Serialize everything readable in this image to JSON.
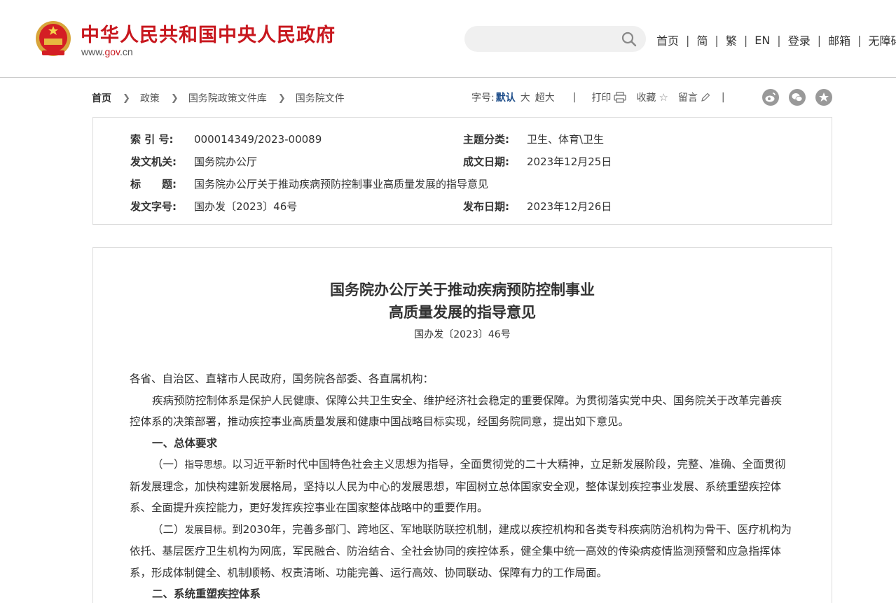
{
  "header": {
    "site_title": "中华人民共和国中央人民政府",
    "site_url_prefix": "www.",
    "site_url_gov": "gov",
    "site_url_suffix": ".cn",
    "search_placeholder": "",
    "links": [
      "首页",
      "简",
      "繁",
      "EN",
      "登录",
      "邮箱",
      "无障碍"
    ],
    "brand_color": "#c8171e"
  },
  "breadcrumb": [
    "首页",
    "政策",
    "国务院政策文件库",
    "国务院文件"
  ],
  "tools": {
    "font_size_label": "字号:",
    "font_sizes": [
      "默认",
      "大",
      "超大"
    ],
    "print": "打印",
    "favorite": "收藏",
    "comment": "留言",
    "separator": "|",
    "share_icons": [
      "weibo-icon",
      "wechat-icon",
      "star-icon"
    ]
  },
  "info": {
    "index_label": "索 引 号:",
    "index_value": "000014349/2023-00089",
    "topic_label": "主题分类:",
    "topic_value": "卫生、体育\\卫生",
    "issuer_label": "发文机关:",
    "issuer_value": "国务院办公厅",
    "written_label": "成文日期:",
    "written_value": "2023年12月25日",
    "title_label": "标　　题:",
    "title_value": "国务院办公厅关于推动疾病预防控制事业高质量发展的指导意见",
    "docno_label": "发文字号:",
    "docno_value": "国办发〔2023〕46号",
    "publish_label": "发布日期:",
    "publish_value": "2023年12月26日"
  },
  "article": {
    "title_line1": "国务院办公厅关于推动疾病预防控制事业",
    "title_line2": "高质量发展的指导意见",
    "doc_no": "国办发〔2023〕46号",
    "salutation": "各省、自治区、直辖市人民政府，国务院各部委、各直属机构：",
    "para1": "疾病预防控制体系是保护人民健康、保障公共卫生安全、维护经济社会稳定的重要保障。为贯彻落实党中央、国务院关于改革完善疾控体系的决策部署，推动疾控事业高质量发展和健康中国战略目标实现，经国务院同意，提出如下意见。",
    "heading1": "一、总体要求",
    "p2_lead": "（一）",
    "p2_em": "指导思想。",
    "p2_text": "以习近平新时代中国特色社会主义思想为指导，全面贯彻党的二十大精神，立足新发展阶段，完整、准确、全面贯彻新发展理念，加快构建新发展格局，坚持以人民为中心的发展思想，牢固树立总体国家安全观，整体谋划疾控事业发展、系统重塑疾控体系、全面提升疾控能力，更好发挥疾控事业在国家整体战略中的重要作用。",
    "p3_lead": "（二）",
    "p3_em": "发展目标。",
    "p3_text": "到2030年，完善多部门、跨地区、军地联防联控机制，建成以疾控机构和各类专科疾病防治机构为骨干、医疗机构为依托、基层医疗卫生机构为网底，军民融合、防治结合、全社会协同的疾控体系，健全集中统一高效的传染病疫情监测预警和应急指挥体系，形成体制健全、机制顺畅、权责清晰、功能完善、运行高效、协同联动、保障有力的工作局面。",
    "heading2": "二、系统重塑疾控体系"
  }
}
